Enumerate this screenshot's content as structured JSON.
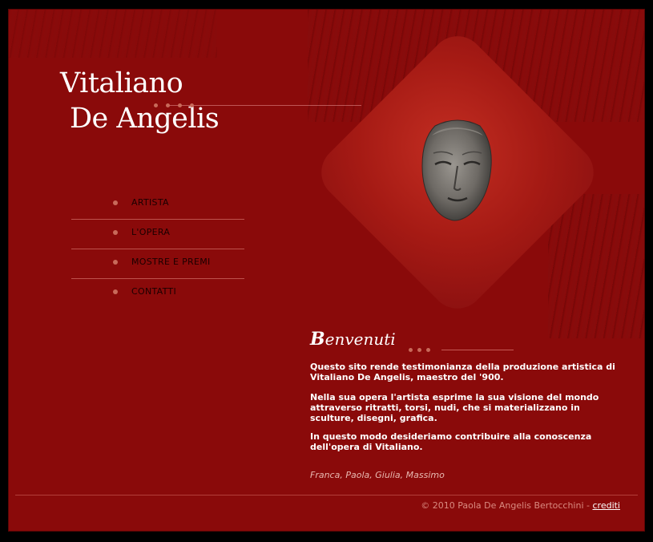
{
  "header": {
    "name_line1": "Vitaliano",
    "name_line2": "De Angelis"
  },
  "nav": {
    "items": [
      {
        "label": "ARTISTA"
      },
      {
        "label": "L'OPERA"
      },
      {
        "label": "MOSTRE E PREMI"
      },
      {
        "label": "CONTATTI"
      }
    ]
  },
  "main": {
    "welcome_first": "B",
    "welcome_rest": "envenuti",
    "paragraphs": [
      "Questo sito rende testimonianza della produzione artistica di Vitaliano De Angelis, maestro del '900.",
      "Nella sua opera l'artista esprime la sua visione del mondo attraverso ritratti, torsi, nudi, che si materializzano in sculture, disegni, grafica.",
      "In questo modo desideriamo contribuire alla conoscenza dell'opera di Vitaliano."
    ],
    "signature": "Franca, Paola, Giulia, Massimo"
  },
  "footer": {
    "copyright": "© 2010 Paola De Angelis Bertocchini -",
    "credits_label": "crediti"
  },
  "colors": {
    "background": "#8a0a0a",
    "accent_dots": "#c86a5a"
  },
  "icons": {
    "bullet": "dot-bullet-icon",
    "hero": "sculpture-face-image"
  }
}
